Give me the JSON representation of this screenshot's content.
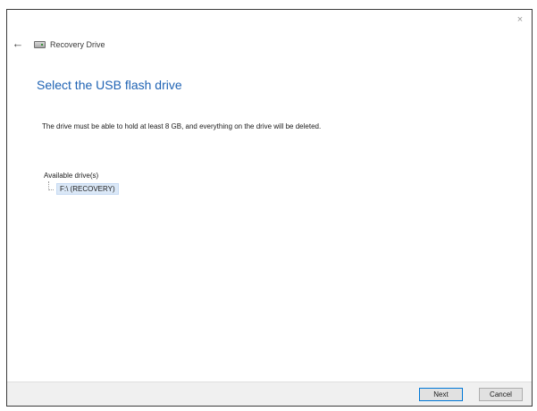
{
  "window": {
    "title": "Recovery Drive",
    "close_glyph": "×",
    "back_glyph": "←"
  },
  "main": {
    "heading": "Select the USB flash drive",
    "description": "The drive must be able to hold at least 8 GB, and everything on the drive will be deleted.",
    "drives_label": "Available drive(s)",
    "drives": [
      {
        "label": "F:\\ (RECOVERY)",
        "selected": true
      }
    ]
  },
  "footer": {
    "next_label": "Next",
    "cancel_label": "Cancel"
  },
  "icons": {
    "window_icon": "drive-icon",
    "back": "back-arrow-icon",
    "close": "close-icon"
  },
  "colors": {
    "heading": "#1f63b4",
    "selection": "#dbe8f7",
    "primary_border": "#0078d7"
  }
}
